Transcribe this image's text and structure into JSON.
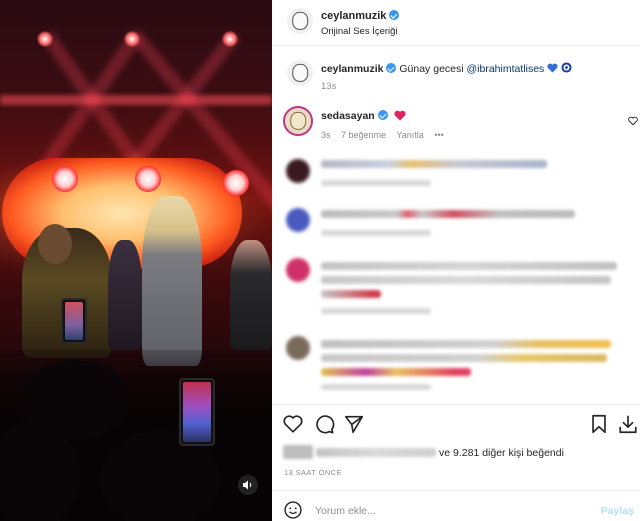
{
  "post": {
    "author": "ceylanmuzik",
    "audio": "Orijinal Ses İçeriği",
    "caption_text": "Günay gecesi",
    "caption_mention": "@ibrahimtatlises",
    "caption_time": "13s"
  },
  "pinned_comment": {
    "user": "sedasayan",
    "time": "3s",
    "likes": "7 beğenme",
    "reply": "Yanıtla",
    "more": "•••"
  },
  "likes": {
    "suffix": "ve 9.281 diğer kişi beğendi"
  },
  "timestamp": "13 SAAT ÖNCE",
  "comment_box": {
    "placeholder": "Yorum ekle...",
    "post_label": "Paylaş"
  },
  "icons": {
    "like": "heart-icon",
    "comment": "comment-icon",
    "share": "send-icon",
    "save": "bookmark-icon",
    "download": "download-icon",
    "emoji": "emoji-icon",
    "sound": "sound-icon",
    "verified": "verified-badge-icon"
  },
  "colors": {
    "verified": "#3897f0",
    "heart": "#ed4956",
    "link": "#00376b",
    "post_button": "#b2dffc"
  }
}
